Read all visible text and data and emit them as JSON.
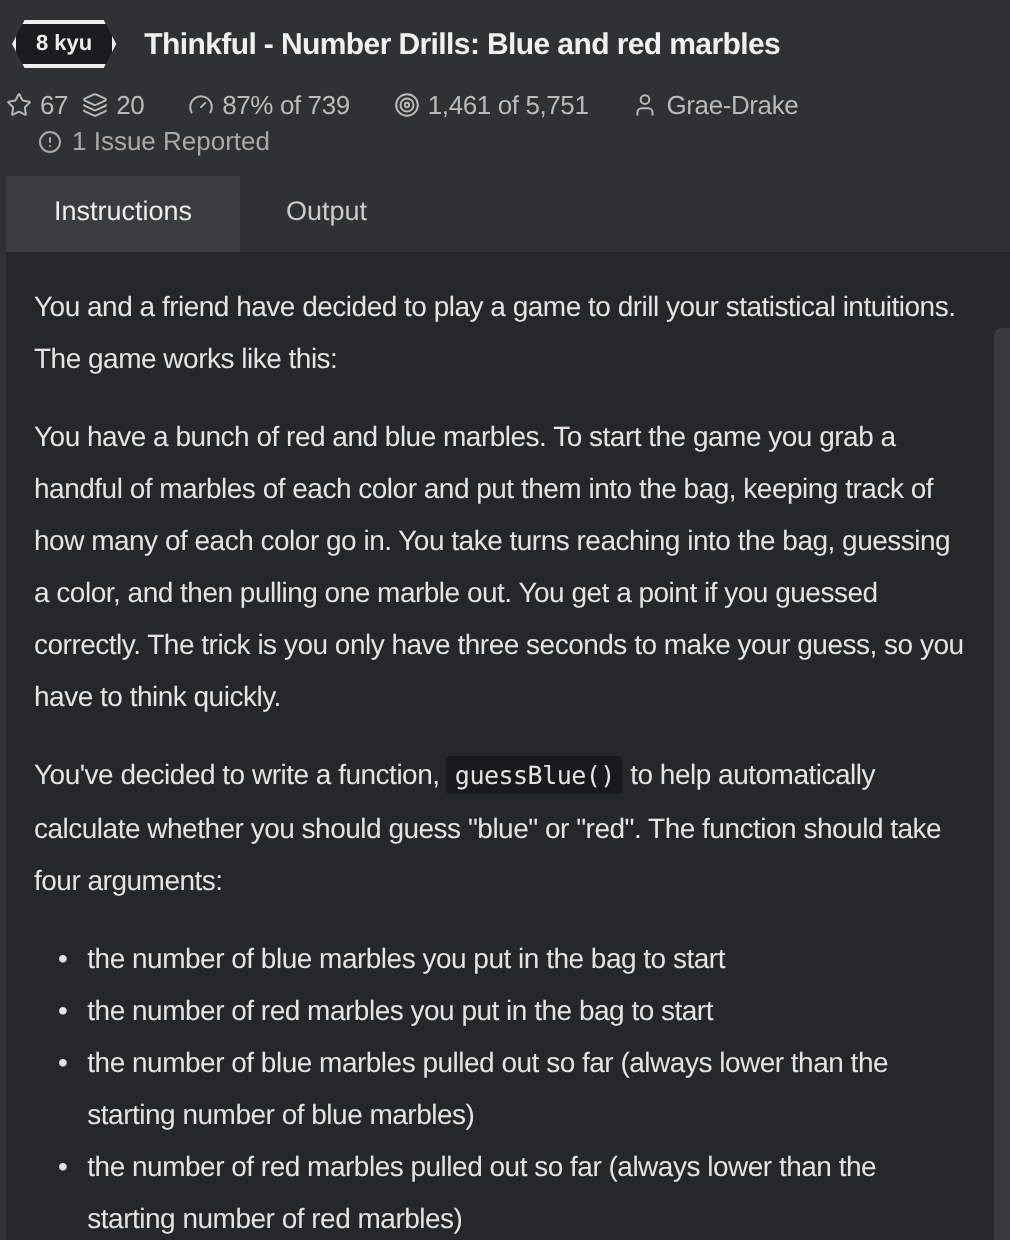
{
  "kata": {
    "rank": "8 kyu",
    "title": "Thinkful - Number Drills: Blue and red marbles"
  },
  "stats": [
    {
      "kind": "stars",
      "text": "67"
    },
    {
      "kind": "collections",
      "text": "20"
    },
    {
      "kind": "satisfaction",
      "text": "87% of 739"
    },
    {
      "kind": "completions",
      "text": "1,461 of 5,751"
    },
    {
      "kind": "author",
      "text": "Grae-Drake"
    }
  ],
  "issues": "1 Issue Reported",
  "tabs": [
    {
      "label": "Instructions",
      "selected": true
    },
    {
      "label": "Output",
      "selected": false
    }
  ],
  "description": [
    {
      "kind": "paragraph",
      "text": "You and a friend have decided to play a game to drill your statistical intuitions. The game works like this:"
    },
    {
      "kind": "paragraph",
      "text": "You have a bunch of red and blue marbles. To start the game you grab a handful of marbles of each color and put them into the bag, keeping track of how many of each color go in. You take turns reaching into the bag, guessing a color, and then pulling one marble out. You get a point if you guessed correctly. The trick is you only have three seconds to make your guess, so you have to think quickly."
    },
    {
      "kind": "code_paragraph",
      "before": "You've decided to write a function, ",
      "code": "guessBlue()",
      "after": " to help automatically calculate whether you should guess \"blue\" or \"red\". The function should take four arguments:"
    },
    {
      "kind": "list",
      "bullet": "•",
      "items": [
        "the number of blue marbles you put in the bag to start",
        "the number of red marbles you put in the bag to start",
        "the number of blue marbles pulled out so far (always lower than the starting number of blue marbles)",
        "the number of red marbles pulled out so far (always lower than the starting number of red marbles)"
      ]
    }
  ]
}
